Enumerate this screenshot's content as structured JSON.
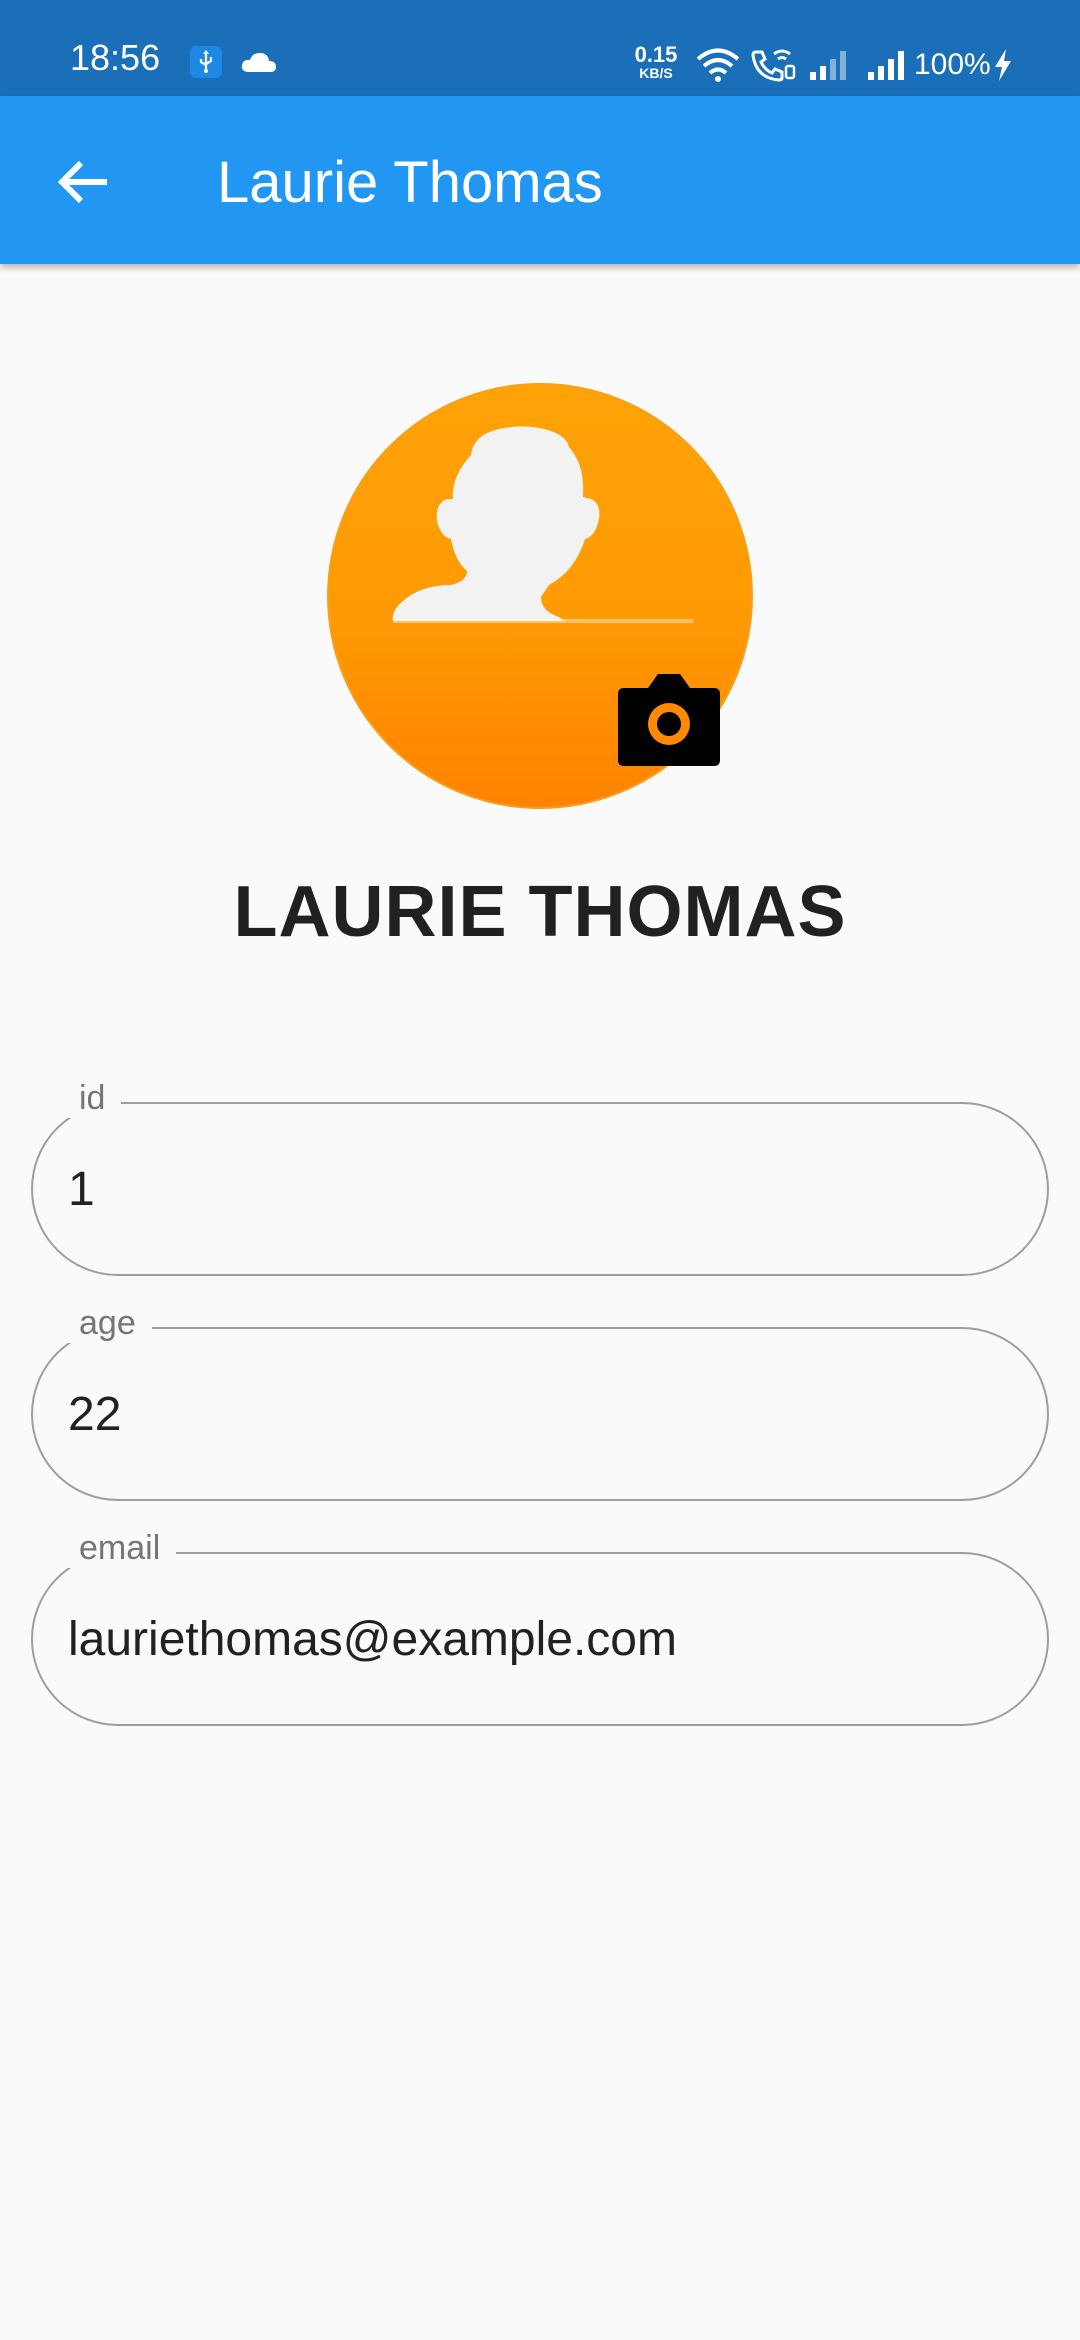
{
  "status_bar": {
    "time": "18:56",
    "net_speed_value": "0.15",
    "net_speed_unit": "KB/S",
    "battery": "100%",
    "icons": [
      "usb-icon",
      "cloud-icon",
      "wifi-icon",
      "wifi-calling-icon",
      "signal-icon",
      "signal-icon",
      "charging-icon"
    ]
  },
  "app_bar": {
    "title": "Laurie Thomas",
    "back_icon": "arrow-back-icon",
    "color": "#2196f3"
  },
  "profile": {
    "name": "LAURIE THOMAS",
    "avatar_icon": "person-silhouette-icon",
    "camera_icon": "camera-icon",
    "avatar_color": "#ff9800"
  },
  "fields": {
    "id": {
      "label": "id",
      "value": "1"
    },
    "age": {
      "label": "age",
      "value": "22"
    },
    "email": {
      "label": "email",
      "value": "lauriethomas@example.com"
    }
  }
}
